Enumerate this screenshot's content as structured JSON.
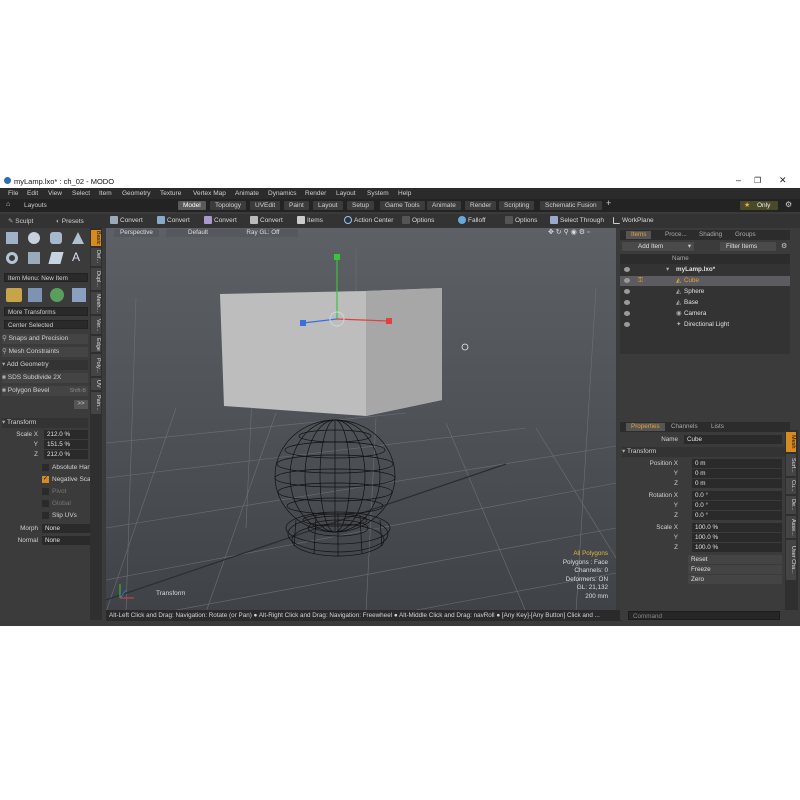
{
  "window": {
    "title": "myLamp.lxo* : ch_02 - MODO",
    "controls": [
      "–",
      "❐",
      "✕"
    ]
  },
  "menu": [
    "File",
    "Edit",
    "View",
    "Select",
    "Item",
    "Geometry",
    "Texture",
    "Vertex Map",
    "Animate",
    "Dynamics",
    "Render",
    "Layout",
    "System",
    "Help"
  ],
  "layouts_label": "Layouts",
  "tabs": [
    "Model",
    "Topology",
    "UVEdit",
    "Paint",
    "Layout",
    "Setup",
    "Game Tools",
    "Animate",
    "Render",
    "Scripting",
    "Schematic Fusion",
    "+"
  ],
  "only_label": "Only",
  "toolbar": {
    "items": [
      "Convert",
      "Convert",
      "Convert",
      "Convert",
      "Items",
      "Action Center",
      "Options",
      "Falloff",
      "Options",
      "Select Through",
      "WorkPlane"
    ]
  },
  "left": {
    "sculpt": "Sculpt",
    "presets": "Presets",
    "item_menu": "Item Menu: New Item",
    "more_transforms": "More Transforms",
    "center_selected": "Center Selected",
    "snaps": "Snaps and Precision",
    "mesh_constraints": "Mesh Constraints",
    "add_geometry": "Add Geometry",
    "sds": "SDS Subdivide 2X",
    "polygon_bevel": "Polygon Bevel",
    "polygon_bevel_key": "Shift-B",
    "transform_header": "Transform",
    "scale_label": "Scale X",
    "axis_y": "Y",
    "axis_z": "Z",
    "scale_x": "212.0 %",
    "scale_y": "151.5 %",
    "scale_z": "212.0 %",
    "absolute_handle": "Absolute Handle",
    "negative_scale": "Negative Scale",
    "pivot": "Pivot",
    "global": "Global",
    "slip_uvs": "Slip UVs",
    "morph_label": "Morph",
    "morph_value": "None",
    "normal_label": "Normal",
    "normal_value": "None",
    "side_tabs": [
      "Basic",
      "Def...",
      "Dupl...",
      "Mesh...",
      "Ver...",
      "Edge",
      "Poly...",
      "UV",
      "Pain..."
    ]
  },
  "viewport": {
    "header": [
      "Perspective",
      "Default",
      "Ray GL: Off"
    ],
    "stats": [
      "All Polygons",
      "Polygons : Face",
      "Channels: 0",
      "Deformers: ON",
      "GL: 21,132",
      "200 mm"
    ],
    "tool_label": "Transform"
  },
  "status": "Alt-Left Click and Drag: Navigation: Rotate (or Pan) ● Alt-Right Click and Drag: Navigation: Freewheel ● Alt-Middle Click and Drag: navRoll ● [Any Key]-[Any Button] Click and ...",
  "items_panel": {
    "tabs": [
      "Items",
      "Proce...",
      "Shading",
      "Groups"
    ],
    "add_item": "Add Item",
    "filter_items": "Filter Items",
    "name_header": "Name",
    "tree": [
      "myLamp.lxo*",
      "Cube",
      "Sphere",
      "Base",
      "Camera",
      "Directional Light"
    ]
  },
  "properties": {
    "tabs": [
      "Properties",
      "Channels",
      "Lists"
    ],
    "name_label": "Name",
    "name_value": "Cube",
    "transform": "Transform",
    "position_label": "Position X",
    "rotation_label": "Rotation X",
    "scale_label": "Scale X",
    "y": "Y",
    "z": "Z",
    "pos": [
      "0 m",
      "0 m",
      "0 m"
    ],
    "rot": [
      "0.0 °",
      "0.0 °",
      "0.0 °"
    ],
    "scl": [
      "100.0 %",
      "100.0 %",
      "100.0 %"
    ],
    "reset": "Reset",
    "freeze": "Freeze",
    "zero": "Zero",
    "side_tabs": [
      "Mesh",
      "Surf...",
      "Cu...",
      "De...",
      "Asse...",
      "User Cha..."
    ],
    "command_placeholder": "Command"
  },
  "colors": {
    "accent": "#d78a1f",
    "x_axis": "#e04040",
    "y_axis": "#3ac43a",
    "z_axis": "#3a6fe0"
  }
}
